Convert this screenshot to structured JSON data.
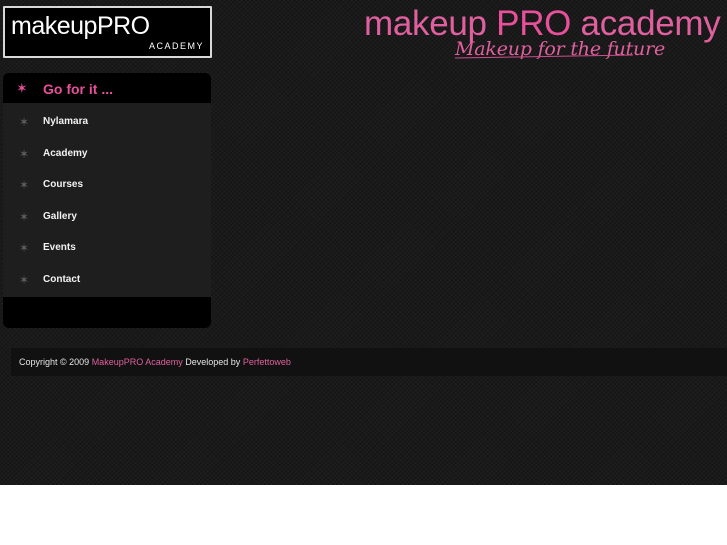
{
  "logo": {
    "brand_main": "makeup",
    "brand_pro": "PRO",
    "sub": "ACADEMY"
  },
  "header": {
    "title_main": "makeup ",
    "title_pro": "PRO",
    "title_rest": " academy",
    "tagline": "Makeup for the future"
  },
  "sidebar": {
    "heading": "Go for it ...",
    "items": [
      {
        "label": "Nylamara"
      },
      {
        "label": "Academy"
      },
      {
        "label": "Courses"
      },
      {
        "label": "Gallery"
      },
      {
        "label": "Events"
      },
      {
        "label": "Contact"
      }
    ]
  },
  "footer": {
    "copyright": "Copyright © 2009",
    "site_link": "MakeupPRO Academy",
    "developed_by": "Developed by",
    "dev_link": "Perfettoweb"
  },
  "colors": {
    "accent": "#e8509a",
    "background": "#1a1a1a"
  },
  "icons": {
    "heading_icon": "star-icon",
    "menu_icon": "star-icon"
  }
}
